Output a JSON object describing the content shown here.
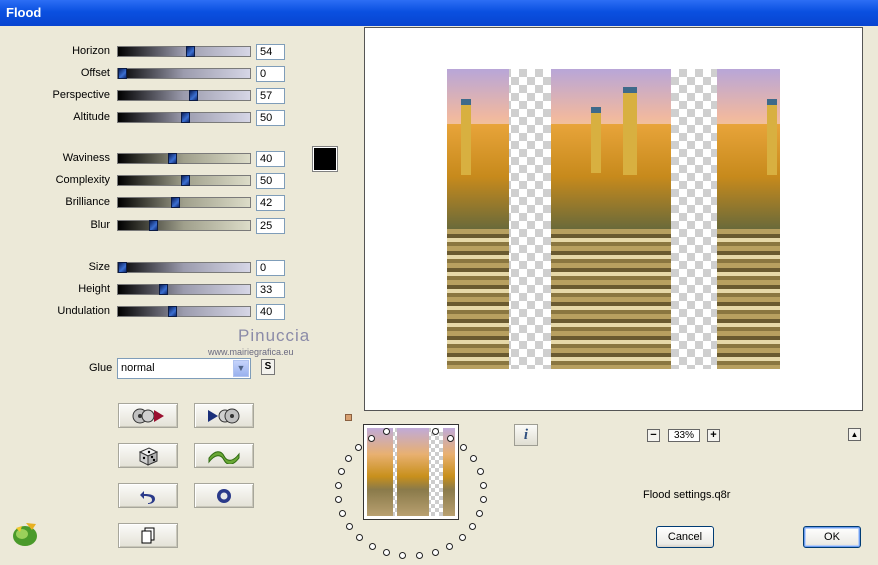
{
  "window": {
    "title": "Flood"
  },
  "sliders": [
    {
      "id": "horizon",
      "label": "Horizon",
      "value": "54",
      "fraction": 0.54,
      "style": "a"
    },
    {
      "id": "offset",
      "label": "Offset",
      "value": "0",
      "fraction": 0.0,
      "style": "a"
    },
    {
      "id": "perspective",
      "label": "Perspective",
      "value": "57",
      "fraction": 0.57,
      "style": "a"
    },
    {
      "id": "altitude",
      "label": "Altitude",
      "value": "50",
      "fraction": 0.5,
      "style": "a"
    },
    {
      "id": "waviness",
      "label": "Waviness",
      "value": "40",
      "fraction": 0.4,
      "style": "b"
    },
    {
      "id": "complexity",
      "label": "Complexity",
      "value": "50",
      "fraction": 0.5,
      "style": "b"
    },
    {
      "id": "brilliance",
      "label": "Brilliance",
      "value": "42",
      "fraction": 0.42,
      "style": "b"
    },
    {
      "id": "blur",
      "label": "Blur",
      "value": "25",
      "fraction": 0.25,
      "style": "b"
    },
    {
      "id": "size",
      "label": "Size",
      "value": "0",
      "fraction": 0.0,
      "style": "a"
    },
    {
      "id": "height",
      "label": "Height",
      "value": "33",
      "fraction": 0.33,
      "style": "a"
    },
    {
      "id": "undulation",
      "label": "Undulation",
      "value": "40",
      "fraction": 0.4,
      "style": "a"
    }
  ],
  "color_swatch": {
    "color": "#000000"
  },
  "watermark": {
    "name": "Pinuccia",
    "url": "www.mairiegrafica.eu"
  },
  "glue": {
    "label": "Glue",
    "value": "normal",
    "s_button": "S"
  },
  "preview": {
    "zoom": "33%"
  },
  "settings_file": "Flood settings.q8r",
  "buttons": {
    "cancel": "Cancel",
    "ok": "OK"
  },
  "colors": {
    "title_bar": "#0a50e0",
    "panel_bg": "#ece9d8",
    "slider_thumb": "#3b6fd1"
  }
}
